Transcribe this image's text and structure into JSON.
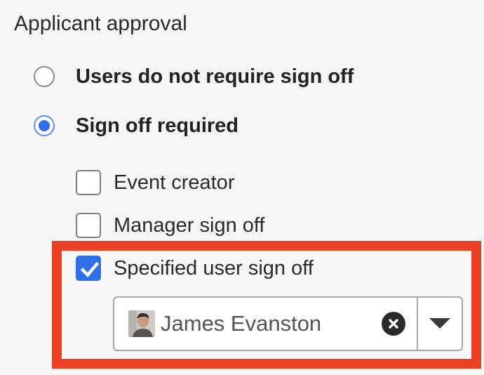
{
  "section": {
    "title": "Applicant approval"
  },
  "radios": [
    {
      "label": "Users do not require sign off",
      "checked": false
    },
    {
      "label": "Sign off required",
      "checked": true
    }
  ],
  "checkboxes": [
    {
      "label": "Event creator",
      "checked": false
    },
    {
      "label": "Manager sign off",
      "checked": false
    },
    {
      "label": "Specified user sign off",
      "checked": true
    }
  ],
  "user_select": {
    "value": "James Evanston",
    "avatar_icon": "user-avatar",
    "clear_icon": "close-circle-icon",
    "dropdown_icon": "caret-down-icon"
  },
  "colors": {
    "accent": "#2f6fe8",
    "highlight": "#ea4127"
  }
}
